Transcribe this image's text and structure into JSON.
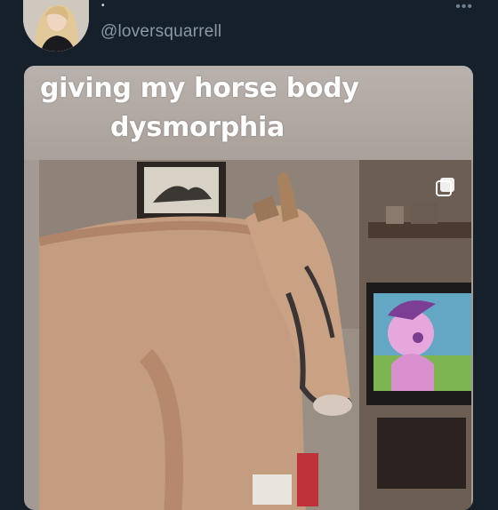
{
  "post": {
    "author_dot": "•",
    "handle": "@loversquarrell",
    "more_icon": "ellipsis-icon",
    "meme_caption_line1": "giving my horse body",
    "meme_caption_line2": "dysmorphia"
  },
  "colors": {
    "background": "#15202b",
    "handle": "#8b98a5",
    "caption_text": "#ffffff"
  }
}
